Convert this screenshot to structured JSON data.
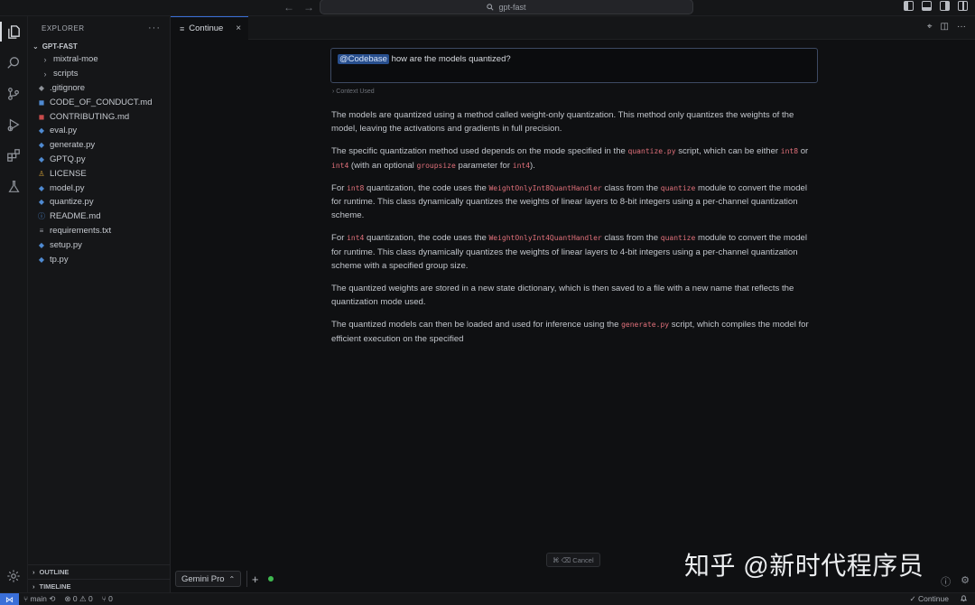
{
  "titlebar": {
    "back": "←",
    "forward": "→",
    "search_label": "gpt-fast"
  },
  "sidebar": {
    "header": "EXPLORER",
    "more": "···",
    "folder": "GPT-FAST",
    "items": [
      {
        "label": "mixtral-moe",
        "icon": "chevron-right-icon"
      },
      {
        "label": "scripts",
        "icon": "chevron-right-icon"
      },
      {
        "label": ".gitignore",
        "icon": "git-file-icon"
      },
      {
        "label": "CODE_OF_CONDUCT.md",
        "icon": "markdown-file-icon"
      },
      {
        "label": "CONTRIBUTING.md",
        "icon": "markdown-file-icon"
      },
      {
        "label": "eval.py",
        "icon": "python-file-icon"
      },
      {
        "label": "generate.py",
        "icon": "python-file-icon"
      },
      {
        "label": "GPTQ.py",
        "icon": "python-file-icon"
      },
      {
        "label": "LICENSE",
        "icon": "license-file-icon"
      },
      {
        "label": "model.py",
        "icon": "python-file-icon"
      },
      {
        "label": "quantize.py",
        "icon": "python-file-icon"
      },
      {
        "label": "README.md",
        "icon": "info-file-icon"
      },
      {
        "label": "requirements.txt",
        "icon": "text-file-icon"
      },
      {
        "label": "setup.py",
        "icon": "python-file-icon"
      },
      {
        "label": "tp.py",
        "icon": "python-file-icon"
      }
    ],
    "outline": "OUTLINE",
    "timeline": "TIMELINE"
  },
  "tab": {
    "label": "Continue",
    "close": "×"
  },
  "chat": {
    "mention": "@Codebase",
    "question": " how are the models quantized?",
    "context_used": "› Context Used",
    "p1": "The models are quantized using a method called weight-only quantization. This method only quantizes the weights of the model, leaving the activations and gradients in full precision.",
    "p2_a": "The specific quantization method used depends on the mode specified in the ",
    "p2_code1": "quantize.py",
    "p2_b": " script, which can be either ",
    "p2_code2": "int8",
    "p2_c": " or ",
    "p2_code3": "int4",
    "p2_d": " (with an optional ",
    "p2_code4": "groupsize",
    "p2_e": " parameter for ",
    "p2_code5": "int4",
    "p2_f": ").",
    "p3_a": "For ",
    "p3_code1": "int8",
    "p3_b": " quantization, the code uses the ",
    "p3_code2": "WeightOnlyInt8QuantHandler",
    "p3_c": " class from the ",
    "p3_code3": "quantize",
    "p3_d": " module to convert the model for runtime. This class dynamically quantizes the weights of linear layers to 8-bit integers using a per-channel quantization scheme.",
    "p4_a": "For ",
    "p4_code1": "int4",
    "p4_b": " quantization, the code uses the ",
    "p4_code2": "WeightOnlyInt4QuantHandler",
    "p4_c": " class from the ",
    "p4_code3": "quantize",
    "p4_d": " module to convert the model for runtime. This class dynamically quantizes the weights of linear layers to 4-bit integers using a per-channel quantization scheme with a specified group size.",
    "p5": "The quantized weights are stored in a new state dictionary, which is then saved to a file with a new name that reflects the quantization mode used.",
    "p6_a": "The quantized models can then be loaded and used for inference using the ",
    "p6_code1": "generate.py",
    "p6_b": " script, which compiles the model for efficient execution on the specified",
    "cancel": "⌘ ⌫ Cancel",
    "model": "Gemini Pro",
    "model_caret": "⌃",
    "add": "+"
  },
  "watermark": "知乎 @新时代程序员",
  "statusbar": {
    "remote": "⋈",
    "branch": "main",
    "sync": "⟲",
    "errors": "⊗ 0",
    "warnings": "⚠ 0",
    "ports": "⑂ 0",
    "continue": "✓ Continue",
    "bell": "🔔"
  },
  "colors": {
    "accent": "#3a6fd8",
    "mention_bg": "#284f8e",
    "code_text": "#e0707a",
    "status_green": "#3fb950"
  }
}
